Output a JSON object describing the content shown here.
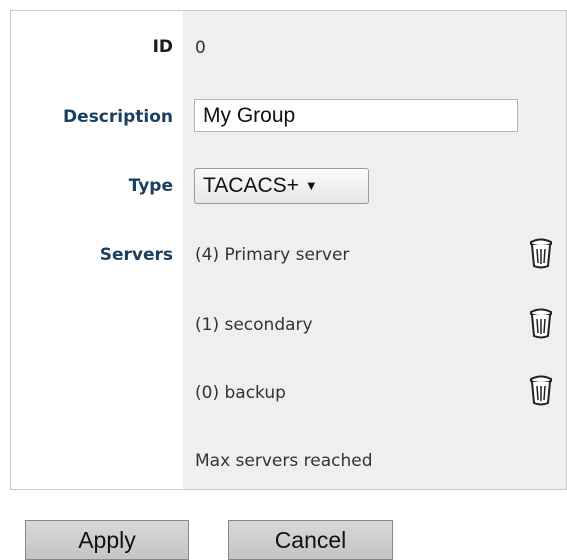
{
  "form": {
    "id_label": "ID",
    "id_value": "0",
    "description_label": "Description",
    "description_value": "My Group",
    "type_label": "Type",
    "type_value": "TACACS+",
    "servers_label": "Servers",
    "servers": [
      {
        "label": "(4) Primary server",
        "delete_icon": "trash-icon"
      },
      {
        "label": "(1) secondary",
        "delete_icon": "trash-icon"
      },
      {
        "label": "(0) backup",
        "delete_icon": "trash-icon"
      }
    ],
    "servers_status": "Max servers reached"
  },
  "buttons": {
    "apply_label": "Apply",
    "cancel_label": "Cancel"
  },
  "colors": {
    "label_blue": "#1b3f5e",
    "value_column_bg": "#efefef"
  }
}
